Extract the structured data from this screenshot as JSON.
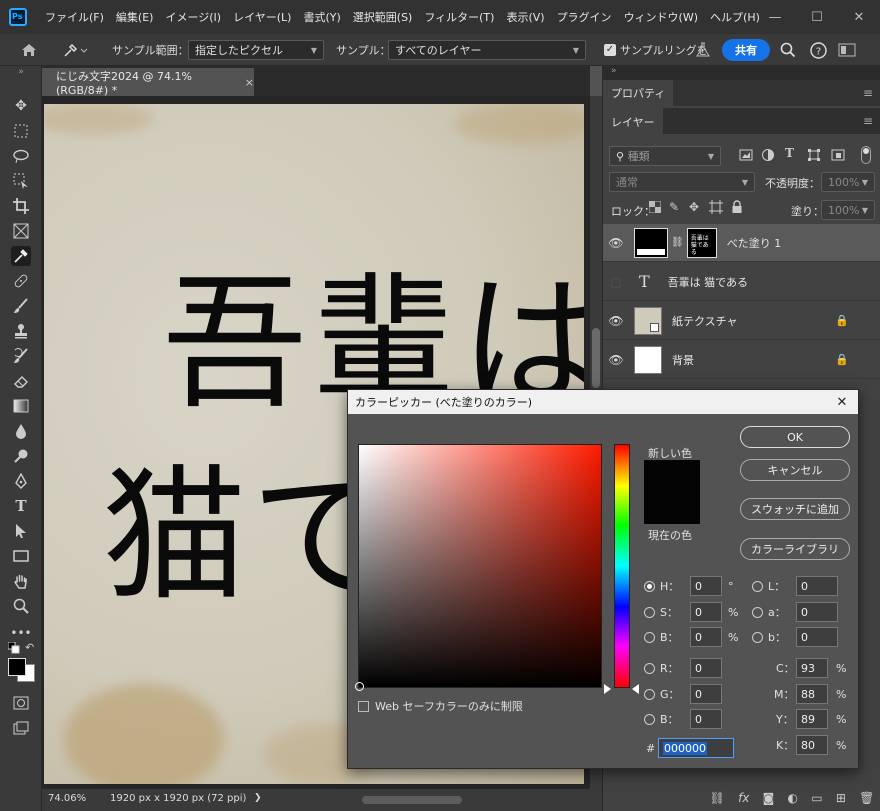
{
  "app": {
    "logo": "Ps"
  },
  "menu": [
    "ファイル(F)",
    "編集(E)",
    "イメージ(I)",
    "レイヤー(L)",
    "書式(Y)",
    "選択範囲(S)",
    "フィルター(T)",
    "表示(V)",
    "プラグイン",
    "ウィンドウ(W)",
    "ヘルプ(H)"
  ],
  "window_controls": {
    "minimize": "—",
    "maximize": "☐",
    "close": "✕"
  },
  "options": {
    "sample_size_label": "サンプル範囲：",
    "sample_size_value": "指定したピクセル",
    "sample_label": "サンプル：",
    "sample_value": "すべてのレイヤー",
    "show_ring_label": "サンプルリングを",
    "share_label": "共有"
  },
  "document": {
    "tab_title": "にじみ文字2024 @ 74.1% (RGB/8#) *",
    "close": "×",
    "line1": "吾輩は",
    "line2": "猫で"
  },
  "status": {
    "zoom": "74.06%",
    "size": "1920 px x 1920 px (72 ppi)",
    "arrow": "❯"
  },
  "panels": {
    "properties_tab": "プロパティ",
    "layers_tab": "レイヤー",
    "filter_label": "種類",
    "blend_mode": "通常",
    "opacity_label": "不透明度：",
    "opacity_value": "100%",
    "lock_label": "ロック：",
    "fill_label": "塗り：",
    "fill_value": "100%",
    "fill_thumb_text": "吾輩は猫である",
    "layers": [
      {
        "name": "べた塗り 1"
      },
      {
        "name": "吾輩は 猫である",
        "type_glyph": "T"
      },
      {
        "name": "紙テクスチャ"
      },
      {
        "name": "背景"
      }
    ]
  },
  "color_picker": {
    "title": "カラーピッカー (べた塗りのカラー)",
    "new_label": "新しい色",
    "current_label": "現在の色",
    "ok": "OK",
    "cancel": "キャンセル",
    "add_swatch": "スウォッチに追加",
    "color_library": "カラーライブラリ",
    "web_safe": "Web セーフカラーのみに制限",
    "hsb": {
      "H": "0",
      "S": "0",
      "B": "0"
    },
    "lab": {
      "L": "0",
      "a": "0",
      "b": "0"
    },
    "rgb": {
      "R": "0",
      "G": "0",
      "B": "0"
    },
    "cmyk": {
      "C": "93",
      "M": "88",
      "Y": "89",
      "K": "80"
    },
    "hex_label": "#",
    "hex": "000000",
    "units": {
      "deg": "°",
      "pct": "%"
    },
    "new_color": "#040404",
    "current_color": "#040404"
  },
  "colors": {
    "accent": "#1473e6",
    "ps_blue": "#31a8ff"
  }
}
